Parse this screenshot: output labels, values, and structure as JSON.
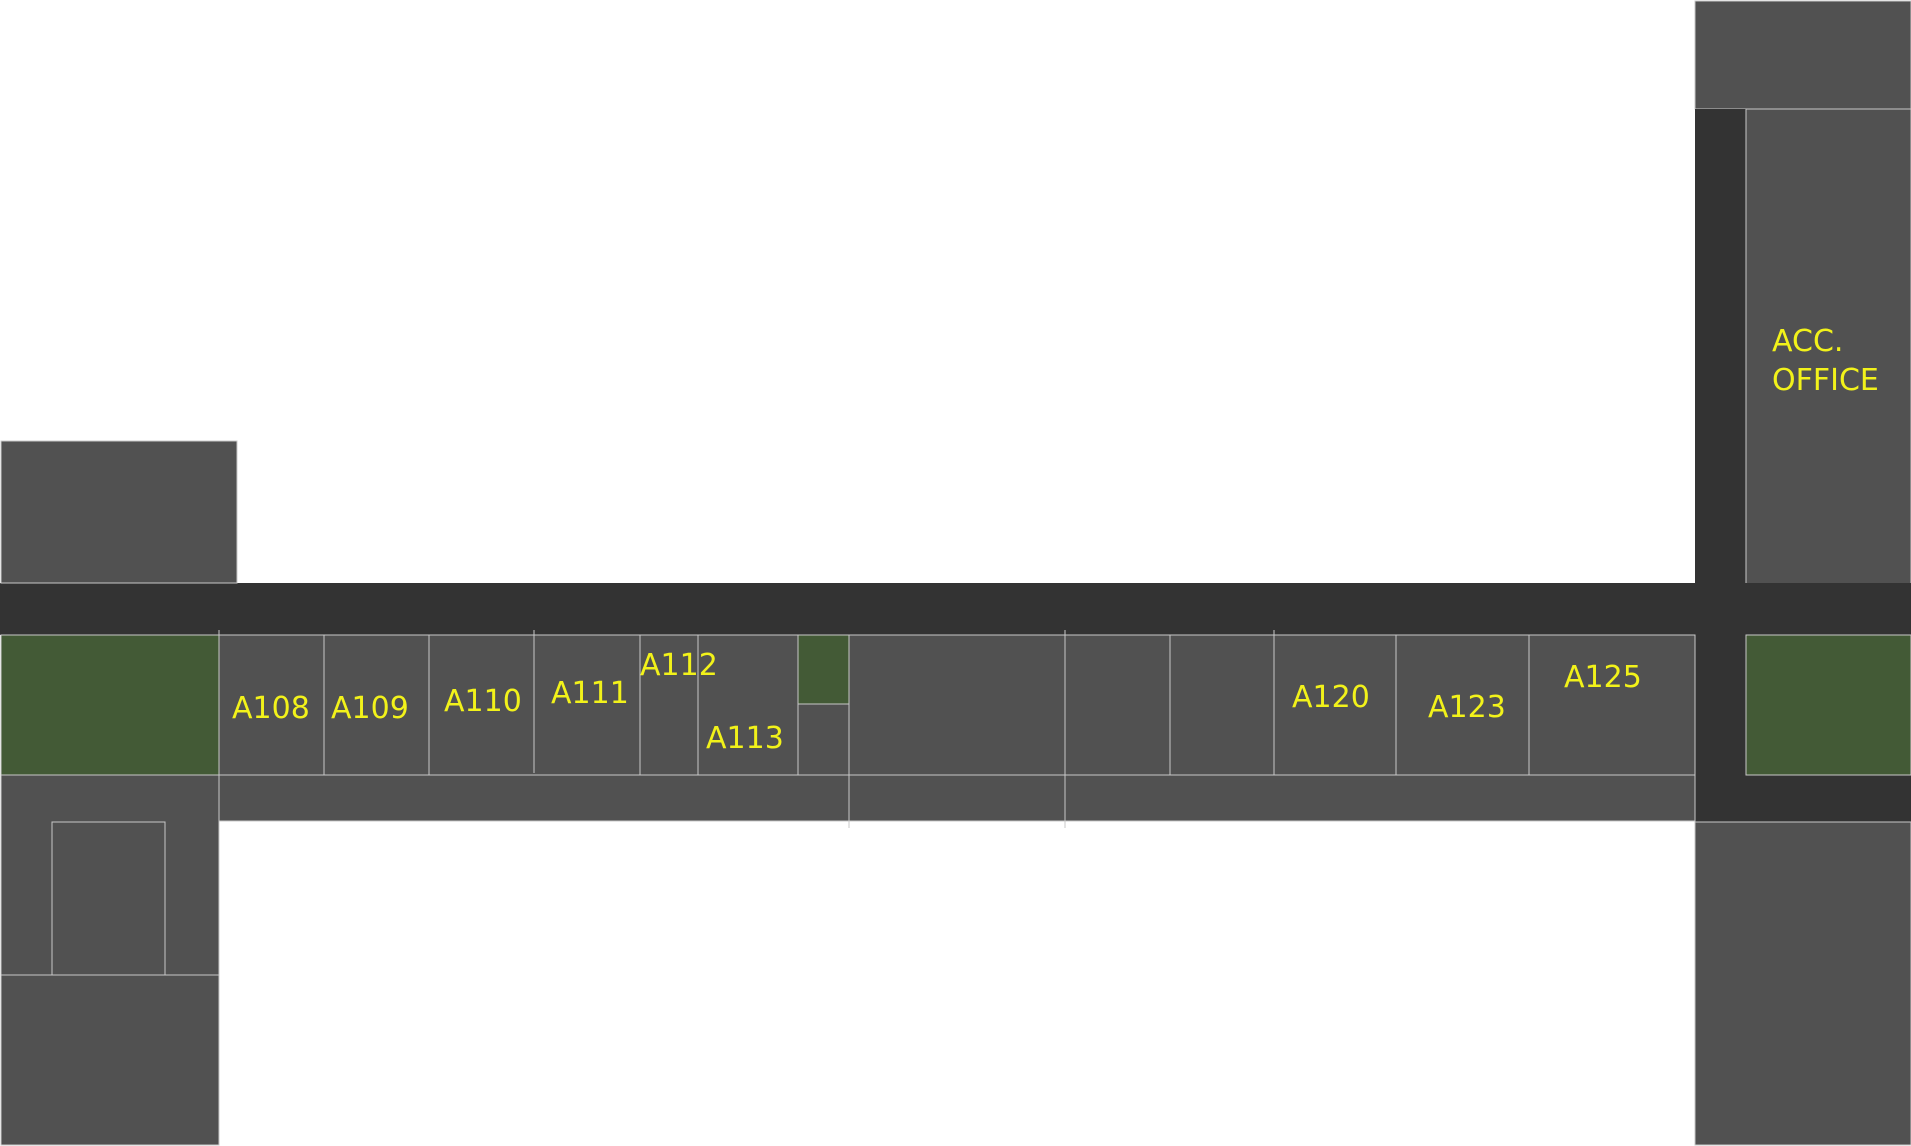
{
  "colors": {
    "room": "#515151",
    "corridor": "#333333",
    "green_area": "#435a36",
    "wall_line": "#c8c8c8",
    "label": "#f2f21a",
    "background": "#ffffff"
  },
  "rooms": {
    "a108": "A108",
    "a109": "A109",
    "a110": "A110",
    "a111": "A111",
    "a112": "A112",
    "a113": "A113",
    "a120": "A120",
    "a123": "A123",
    "a125": "A125",
    "acc_office_line1": "ACC.",
    "acc_office_line2": "OFFICE"
  }
}
